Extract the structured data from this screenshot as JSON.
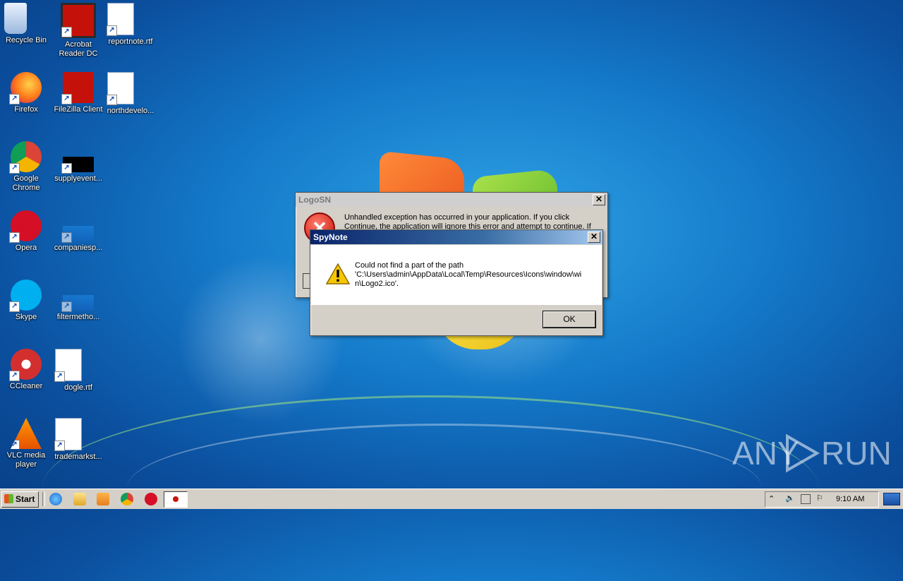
{
  "desktop": {
    "icons": [
      {
        "label": "Recycle Bin",
        "icon": "recycle-bin-icon"
      },
      {
        "label": "Acrobat Reader DC",
        "icon": "acrobat-icon"
      },
      {
        "label": "reportnote.rtf",
        "icon": "word-doc-icon"
      },
      {
        "label": "Firefox",
        "icon": "firefox-icon"
      },
      {
        "label": "FileZilla Client",
        "icon": "filezilla-icon"
      },
      {
        "label": "northdevelo...",
        "icon": "word-doc-icon"
      },
      {
        "label": "Google Chrome",
        "icon": "chrome-icon"
      },
      {
        "label": "supplyevent...",
        "icon": "black-file-icon"
      },
      {
        "label": "Opera",
        "icon": "opera-icon"
      },
      {
        "label": "companiesp...",
        "icon": "blank-file-icon"
      },
      {
        "label": "Skype",
        "icon": "skype-icon"
      },
      {
        "label": "filtermetho...",
        "icon": "blank-file-icon"
      },
      {
        "label": "CCleaner",
        "icon": "ccleaner-icon"
      },
      {
        "label": "dogle.rtf",
        "icon": "word-doc-icon"
      },
      {
        "label": "VLC media player",
        "icon": "vlc-icon"
      },
      {
        "label": "trademarkst...",
        "icon": "word-doc-icon"
      }
    ]
  },
  "error_dialog": {
    "title": "LogoSN",
    "close": "✕",
    "message": "Unhandled exception has occurred in your application. If you click Continue, the application will ignore this error and attempt to continue. If"
  },
  "spynote_dialog": {
    "title": "SpyNote",
    "close": "✕",
    "message_line1": "Could not find a part of the path",
    "message_line2": "'C:\\Users\\admin\\AppData\\Local\\Temp\\Resources\\Icons\\window\\wi",
    "message_line3": "n\\Logo2.ico'.",
    "ok_label": "OK"
  },
  "watermark": {
    "text_left": "ANY",
    "text_right": "RUN"
  },
  "taskbar": {
    "start_label": "Start",
    "clock": "9:10 AM",
    "pinned": [
      "ie-icon",
      "explorer-icon",
      "media-player-icon",
      "chrome-icon",
      "opera-icon",
      "app-icon"
    ]
  },
  "colors": {
    "desktop_blue": "#1479c9",
    "title_active": "#0a246a",
    "taskbar": "#d4d0c8"
  }
}
